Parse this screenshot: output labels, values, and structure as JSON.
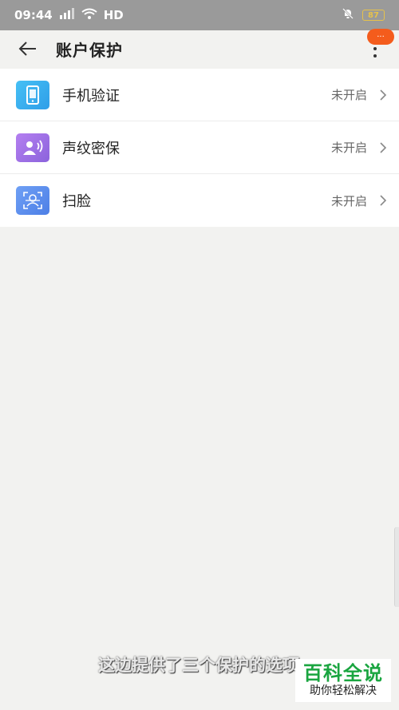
{
  "status_bar": {
    "time": "09:44",
    "network": "HD",
    "battery": "87"
  },
  "header": {
    "title": "账户保护"
  },
  "more_badge": "···",
  "protection_items": [
    {
      "label": "手机验证",
      "status": "未开启"
    },
    {
      "label": "声纹密保",
      "status": "未开启"
    },
    {
      "label": "扫脸",
      "status": "未开启"
    }
  ],
  "subtitle": "这边提供了三个保护的选项",
  "watermark": {
    "main": "百科全说",
    "sub": "助你轻松解决"
  },
  "colors": {
    "phone_icon_bg": "#3bb4f2",
    "voice_icon_bg": "#a074e6",
    "face_icon_bg": "#5b8ef0",
    "badge": "#f45c1c",
    "watermark_green": "#1aa540"
  }
}
